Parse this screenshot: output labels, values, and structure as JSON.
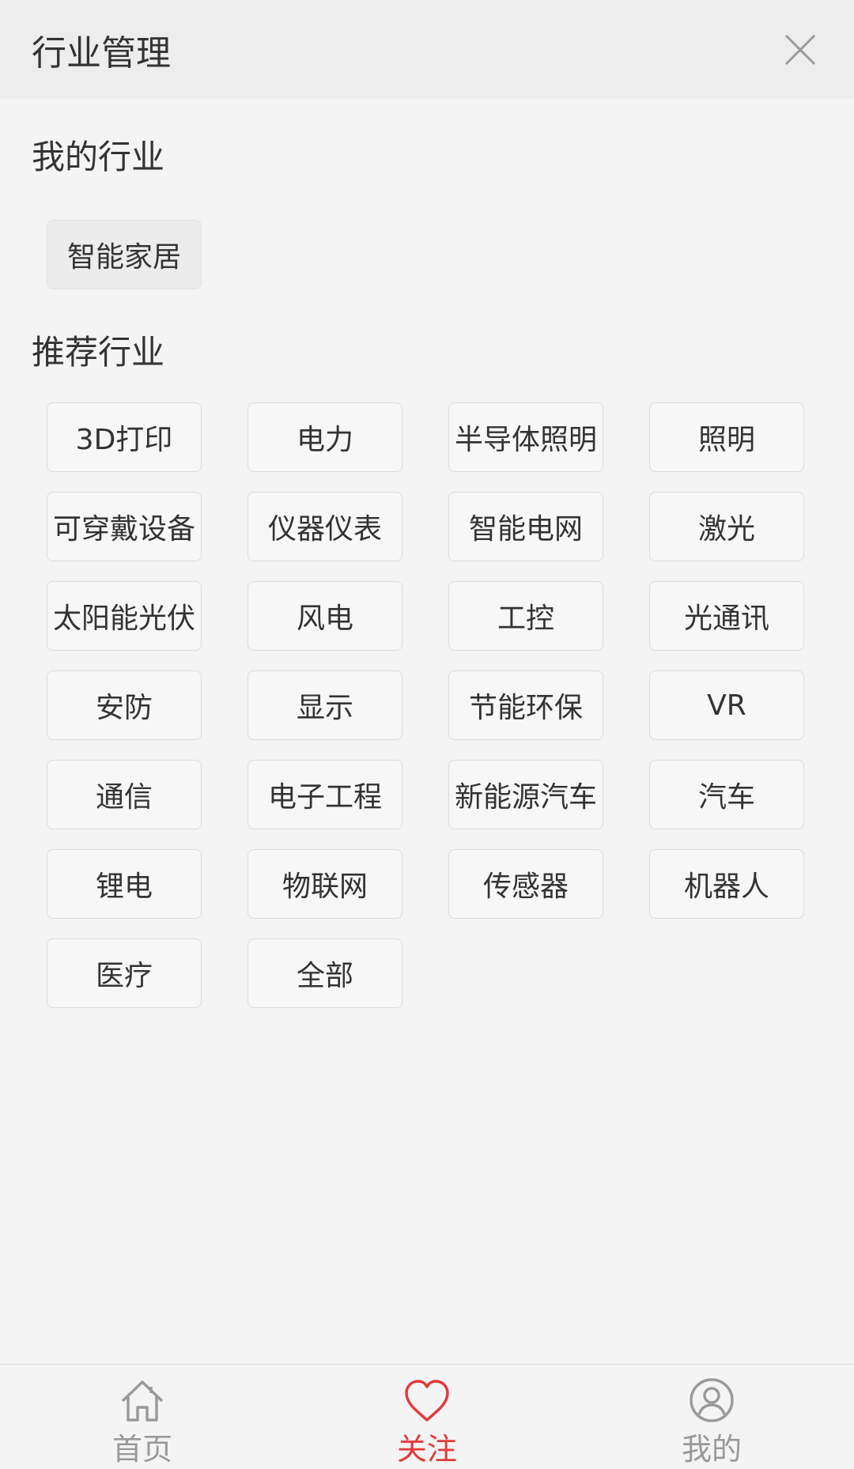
{
  "header": {
    "title": "行业管理",
    "close_icon": "close-icon"
  },
  "my_industry": {
    "title": "我的行业",
    "tags": [
      "智能家居"
    ]
  },
  "recommended": {
    "title": "推荐行业",
    "tags": [
      "3D打印",
      "电力",
      "半导体照明",
      "照明",
      "可穿戴设备",
      "仪器仪表",
      "智能电网",
      "激光",
      "太阳能光伏",
      "风电",
      "工控",
      "光通讯",
      "安防",
      "显示",
      "节能环保",
      "VR",
      "通信",
      "电子工程",
      "新能源汽车",
      "汽车",
      "锂电",
      "物联网",
      "传感器",
      "机器人",
      "医疗",
      "全部"
    ]
  },
  "bottom_nav": {
    "items": [
      {
        "label": "首页",
        "icon": "home-icon",
        "active": false
      },
      {
        "label": "关注",
        "icon": "heart-icon",
        "active": true
      },
      {
        "label": "我的",
        "icon": "user-icon",
        "active": false
      }
    ]
  },
  "colors": {
    "active": "#e23b3b",
    "inactive": "#999999"
  }
}
